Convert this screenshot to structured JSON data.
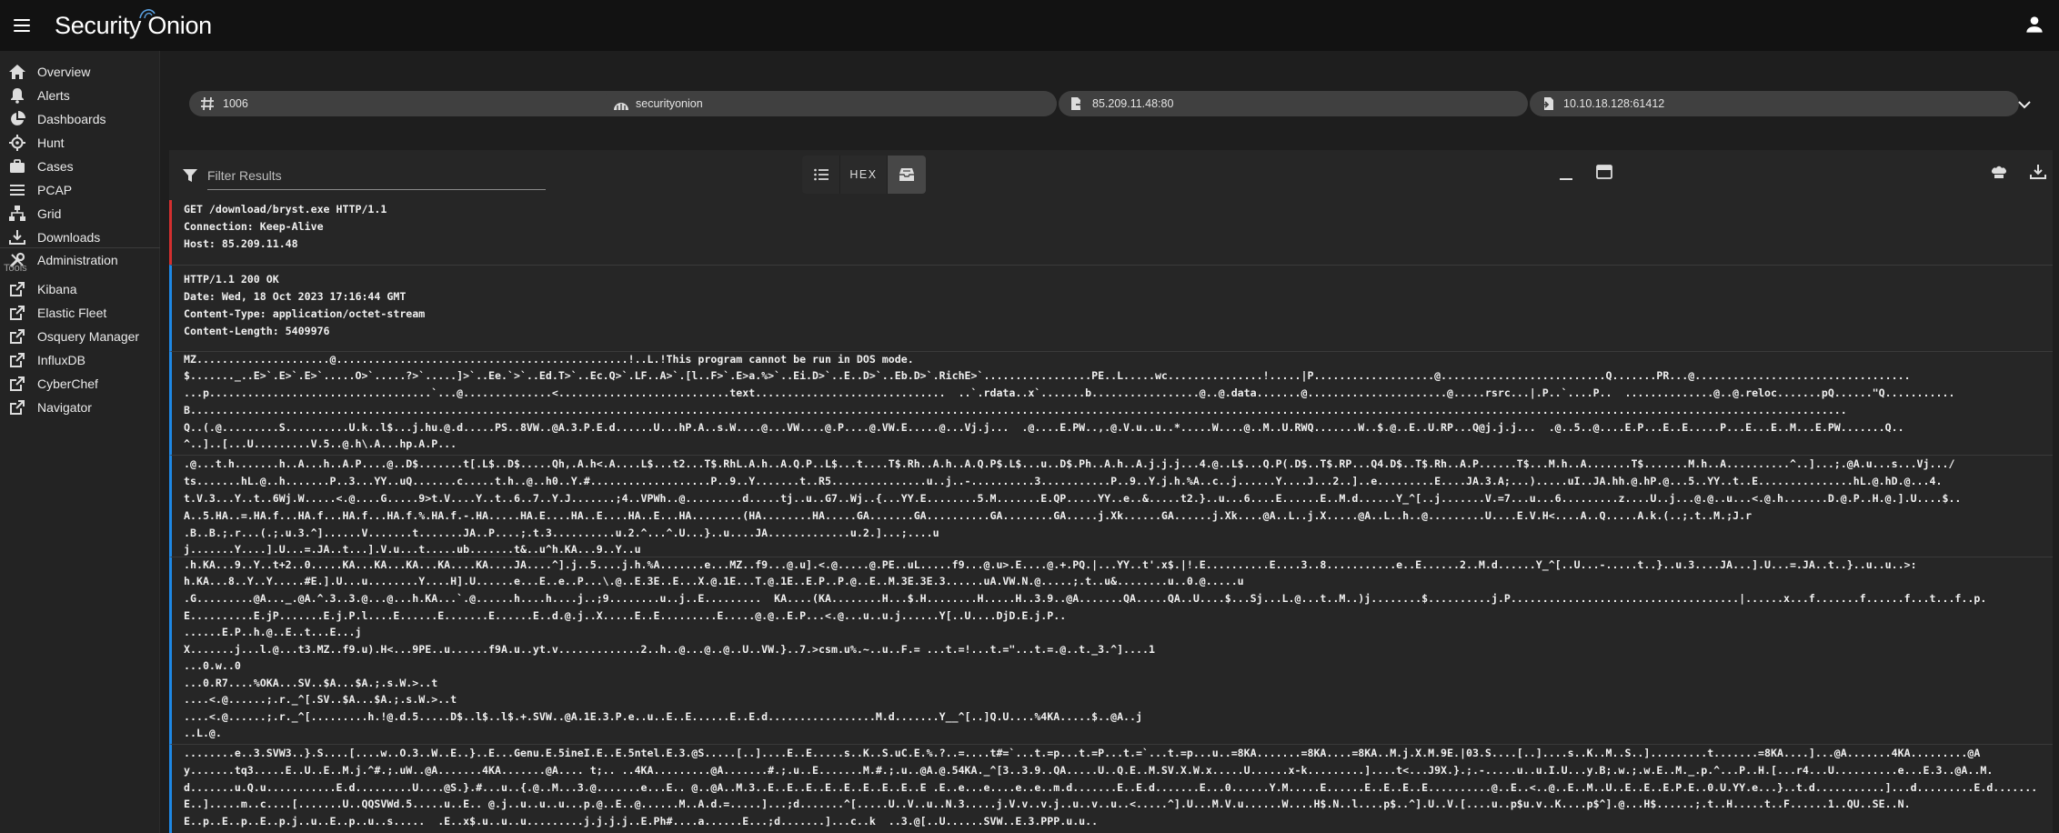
{
  "app": {
    "brand": "Security Onion"
  },
  "sidebar": {
    "items": [
      {
        "label": "Overview",
        "icon": "home-icon"
      },
      {
        "label": "Alerts",
        "icon": "bell-icon"
      },
      {
        "label": "Dashboards",
        "icon": "pie-chart-icon"
      },
      {
        "label": "Hunt",
        "icon": "crosshairs-icon"
      },
      {
        "label": "Cases",
        "icon": "briefcase-icon"
      },
      {
        "label": "PCAP",
        "icon": "list-lines-icon"
      },
      {
        "label": "Grid",
        "icon": "sitemap-icon"
      },
      {
        "label": "Downloads",
        "icon": "download-tray-icon"
      },
      {
        "label": "Administration",
        "icon": "tools-icon"
      }
    ],
    "tools_label": "Tools",
    "tools": [
      {
        "label": "Kibana",
        "icon": "external-link-icon"
      },
      {
        "label": "Elastic Fleet",
        "icon": "external-link-icon"
      },
      {
        "label": "Osquery Manager",
        "icon": "external-link-icon"
      },
      {
        "label": "InfluxDB",
        "icon": "external-link-icon"
      },
      {
        "label": "CyberChef",
        "icon": "external-link-icon"
      },
      {
        "label": "Navigator",
        "icon": "external-link-icon"
      }
    ]
  },
  "chips": {
    "id": "1006",
    "sensor": "securityonion",
    "source": "85.209.11.48:80",
    "destination": "10.10.18.128:61412"
  },
  "filter": {
    "placeholder": "Filter Results"
  },
  "view_toggle": {
    "hex_label": "HEX",
    "active": "payload"
  },
  "packets": [
    {
      "direction": "client",
      "lines": [
        "GET /download/bryst.exe HTTP/1.1",
        "Connection: Keep-Alive",
        "Host: 85.209.11.48"
      ]
    },
    {
      "direction": "server",
      "lines": [
        "HTTP/1.1 200 OK",
        "Date: Wed, 18 Oct 2023 17:16:44 GMT",
        "Content-Type: application/octet-stream",
        "Content-Length: 5409976"
      ]
    },
    {
      "direction": "server",
      "binary": [
        "MZ.....................@..............................................!..L.!This program cannot be run in DOS mode.",
        "$......._..E>`.E>`.E>`.....O>`.....?>`.....]>`..Ee.`>`..Ed.T>`..Ec.Q>`.LF..A>`.[l..F>`.E>a.%>`..Ei.D>`..E..D>`..Eb.D>`.RichE>`.................PE..L.....wc...............!.....|P...................@..........................Q.......PR...@..................................",
        "...p...................................`...@..............<...........................text..............................  ..`.rdata..x`.......b.................@..@.data.......@......................@.....rsrc...|.P..`....P..  ..............@..@.reloc.......pQ......\"Q...........",
        "B.....................................................................................................................................................................................................................................................................",
        "Q..(.@.........S..........U.k..l$...j.hu.@.d.....PS..8VW..@A.3.P.E.d......U...hP.A..s.W....@...VW....@.P....@.VW.E.....@...Vj.j...  .@....E.PW..,.@.V.u..u..*.....W....@..M..U.RWQ.......W..$.@..E..U.RP...Q@j.j.j...  .@..5..@....E.P...E..E.....P...E...E..M...E.PW.......Q..",
        "^..]..[...U.........V.5..@.h\\.A...hp.A.P..."
      ],
      "height": 116
    },
    {
      "direction": "server",
      "binary": [
        ".@...t.h.......h..A...h..A.P....@..D$.......t[.L$..D$.....Qh,.A.h<.A....L$...t2...T$.RhL.A.h..A.Q.P..L$...t....T$.Rh..A.h..A.Q.P$.L$...u..D$.Ph..A.h..A.j.j.j...4.@..L$...Q.P(.D$..T$.RP...Q4.D$..T$.Rh..A.P......T$...M.h..A.......T$.......M.h..A..........^..]...;.@A.u...s...Vj.../",
        "ts.......hL.@..h.......P..3...YY..uQ.......c.....t.h..@..h0..Y.#...................P..9..Y.......t..R5...............u..j..-..........3...........P..9..Y.j.h.%A..c..j......Y....J...2..]..e.........E....JA.3.A;...).....uI..JA.hh.@.hP.@...5..YY..t..E...............hL.@.hD.@...4.",
        "t.V.3...Y..t..6Wj.W.....<.@....G.....9>t.V....Y..t..6..7..Y.J.......;4..VPWh..@.........d.....tj..u..G7..Wj..{...YY.E........5.M.......E.QP.....YY..e..&.....t2.}..u...6....E......E..M.d......Y_^[..j.......V.=7...u...6.........z....U..j...@.@..u...<.@.h.......D.@.P..H.@.].U....$..",
        "A..5.HA..=.HA.f...HA.f...HA.f...HA.f.%.HA.f.-.HA.....HA.E....HA..E....HA..E...HA........(HA........HA.....GA.......GA..........GA........GA.....j.Xk......GA......j.Xk....@A..L..j.X.....@A..L..h..@.........U....E.V.H<....A..Q.....A.k.(..;.t..M.;J.r",
        ".B..B.;.r...(.;.u.3.^]......V.......t.......JA..P....;.t.3..........u.2.^...^.U...}..u....JA.............u.2.]...;....u",
        "j.......Y....].U...=.JA..t...].V.u...t.....ub.......t&..u^h.KA...9..Y..u"
      ],
      "height": 144
    },
    {
      "direction": "server",
      "binary": [
        ".h.KA...9..Y..t+2..0.....KA...KA...KA...KA....KA....JA....^].j..5....j.h.%A.......e...MZ..f9...@.u].<.@.....@.PE..uL.....f9...@.u>.E....@.+.PQ.|...YY..t'.x$.|!.E..........E....3..8...........e..E......2..M.d......Y_^[..U...-.....t..}..u.3....JA...].U...=.JA..t..}..u..u..>:",
        "h.KA...8..Y..Y.....#E.].U...u........Y....H].U......e...E..e..P...\\.@..E.3E..E...X.@.1E...T.@.1E..E.P..P.@..E..M.3E.3E.3......uA.VW.N.@.....;.t..u&........u..0.@.....u",
        ".G.........@A..._.@A.^.3..3.@...@...h.KA...`.@......h....h....j..;9........u..j..E.........  KA....(KA........H...$.H........H.....H..3.9..@A.......QA.....QA..U....$...Sj...L.@...t..M..)j........$..........j.P....................................|......x...f.......f......f...t...f..p.",
        "E..........E.jP.......E.j.P.l....E......E.......E......E..d.@.j..X.....E..E.........E.....@.@..E.P...<.@...u..u.j......Y[..U....DjD.E.j.P..",
        "......E.P..h.@..E..t...E...j",
        "X.......j...l.@...t3.MZ..f9.u).H<...9PE..u......f9A.u..yt.v.............2..h..@...@..@..U..VW.}..7.>csm.u%.~..u..F.= ...t.=!...t.=\"...t.=.@..t._3.^]....1",
        "...0.w..0",
        "...0.R7....%OKA...SV..$A...$A.;.s.W.>..t",
        "....<.@......;.r._^[.SV..$A...$A.;.s.W.>..t",
        "....<.@......;.r._^[.........h.!@.d.5.....D$..l$..l$.+.SVW..@A.1E.3.P.e..u..E..E......E..E.d.................M.d.......Y__^[..]Q.U....%4KA.....$..@A..j",
        "..L.@."
      ],
      "height": 208
    },
    {
      "direction": "server",
      "binary": [
        "........e..3.SVW3..}.S....[....w..O.3..W..E..}..E...Genu.E.5ineI.E..E.5ntel.E.3.@S.....[..]....E..E.....s..K..S.uC.E.%.?..=....t#=`...t.=p...t.=P...t.=`...t.=p...u..=8KA.......=8KA....=8KA..M.j.X.M.9E.|03.S....[..]....s..K..M..S..].........t.......=8KA....]...@A.......4KA.........@A",
        "y.......tq3.....E..U..E..M.j.^#.;.uW..@A.......4KA.......@A.... t;.. ..4KA.........@A.......#.;.u..E.......M.#.;.u..@A.@.54KA._^[3..3.9..QA.....U..Q.E..M.SV.X.W.x.....U......x-k.........]....t<...J9X.}.;.-.....u..u.I.U...y.B;.w.;.w.E..M._.p.^...P..H.[...r4...U..........e...E.3..@A..M.",
        "d.......u.Q.u...........E.d.........U....@S.}.#...u..{.@..M...3.@.......e...E.. @..@A..M.3..E..E..E..E..E..E..E..E..E .E..e...e....e..e..m.d.......E..E.d.......E...0......Y.M.....E......E..E..E..E..........@..E..<..@..E..M..U..E..E..E.P.E..0.U.YY.e...}..t.d...........]...d.........E.d.......",
        "E..].....m..c....[.......U..QQSVWd.5.....u..E.. @.j..u..u..u...p.@..E..@......M..A.d.=.....]...;d.......^[.....U..V..u..N.3.....j.V.v..v.j..u..v..u..<.....^].U...M.V.u......W....H$.N..l....p$..^].U..V.[....u..p$u.v..K....p$^].@...H$......;.t..H.....t..F......1..QU..SE..N.",
        "E..p..E..p..E..p.j..u..E..p..u..s.....  .E..x$.u..u..u.........j.j.j.j..E.Ph#....a......E...;d.......]...c..k  ..3.@[..U......SVW..E.3.PPP.u.u.."
      ],
      "height": 120
    }
  ]
}
